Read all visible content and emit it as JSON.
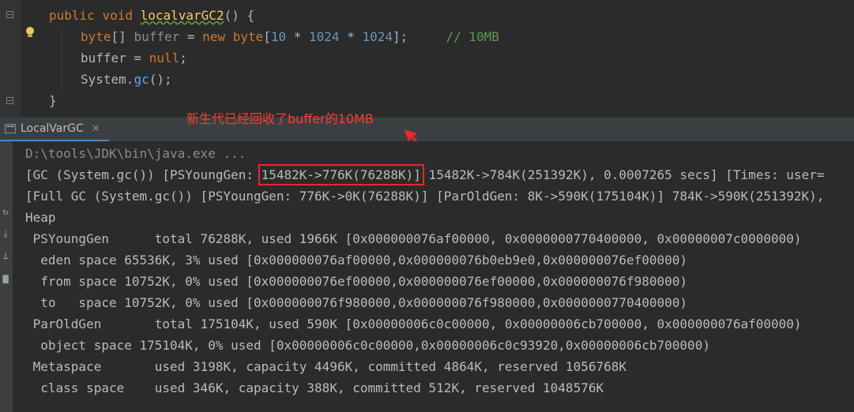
{
  "editor": {
    "line1": {
      "kw_public": "public",
      "kw_void": "void",
      "method_name": "localvarGC2",
      "rest": "() {"
    },
    "line2": {
      "type1": "byte",
      "brackets": "[] ",
      "var": "buffer",
      "eq": " = ",
      "kw_new": "new",
      "sp": " ",
      "type2": "byte",
      "open": "[",
      "n1": "10",
      "op1": " * ",
      "n2": "1024",
      "op2": " * ",
      "n3": "1024",
      "close": "];",
      "gap": "     ",
      "comment": "// 10MB"
    },
    "line3": {
      "var": "buffer",
      "eq": " = ",
      "kw_null": "null",
      "semi": ";"
    },
    "line4": {
      "cls": "System",
      "dot": ".",
      "method": "gc",
      "rest": "();"
    },
    "line5": {
      "brace": "}"
    }
  },
  "run_tab": {
    "label": "LocalVarGC",
    "close": "✕"
  },
  "annotation": {
    "text": "新生代已经回收了buffer的10MB",
    "color": "#ff3b30"
  },
  "console": {
    "cmd": "D:\\tools\\JDK\\bin\\java.exe ...",
    "gc_line": {
      "prefix": "[GC (System.gc()) [PSYoungGen: ",
      "highlight": "15482K->776K(76288K)]",
      "suffix": " 15482K->784K(251392K), 0.0007265 secs] [Times: user="
    },
    "full_gc_line": "[Full GC (System.gc()) [PSYoungGen: 776K->0K(76288K)] [ParOldGen: 8K->590K(175104K)] 784K->590K(251392K),",
    "heap_lines": [
      "Heap",
      " PSYoungGen      total 76288K, used 1966K [0x000000076af00000, 0x0000000770400000, 0x00000007c0000000)",
      "  eden space 65536K, 3% used [0x000000076af00000,0x000000076b0eb9e0,0x000000076ef00000)",
      "  from space 10752K, 0% used [0x000000076ef00000,0x000000076ef00000,0x000000076f980000)",
      "  to   space 10752K, 0% used [0x000000076f980000,0x000000076f980000,0x0000000770400000)",
      " ParOldGen       total 175104K, used 590K [0x00000006c0c00000, 0x00000006cb700000, 0x000000076af00000)",
      "  object space 175104K, 0% used [0x00000006c0c00000,0x00000006c0c93920,0x00000006cb700000)",
      " Metaspace       used 3198K, capacity 4496K, committed 4864K, reserved 1056768K",
      "  class space    used 346K, capacity 388K, committed 512K, reserved 1048576K"
    ]
  },
  "side_icons": [
    "rerun-icon",
    "scroll-to-end-icon",
    "pin-icon",
    "trash-icon"
  ]
}
